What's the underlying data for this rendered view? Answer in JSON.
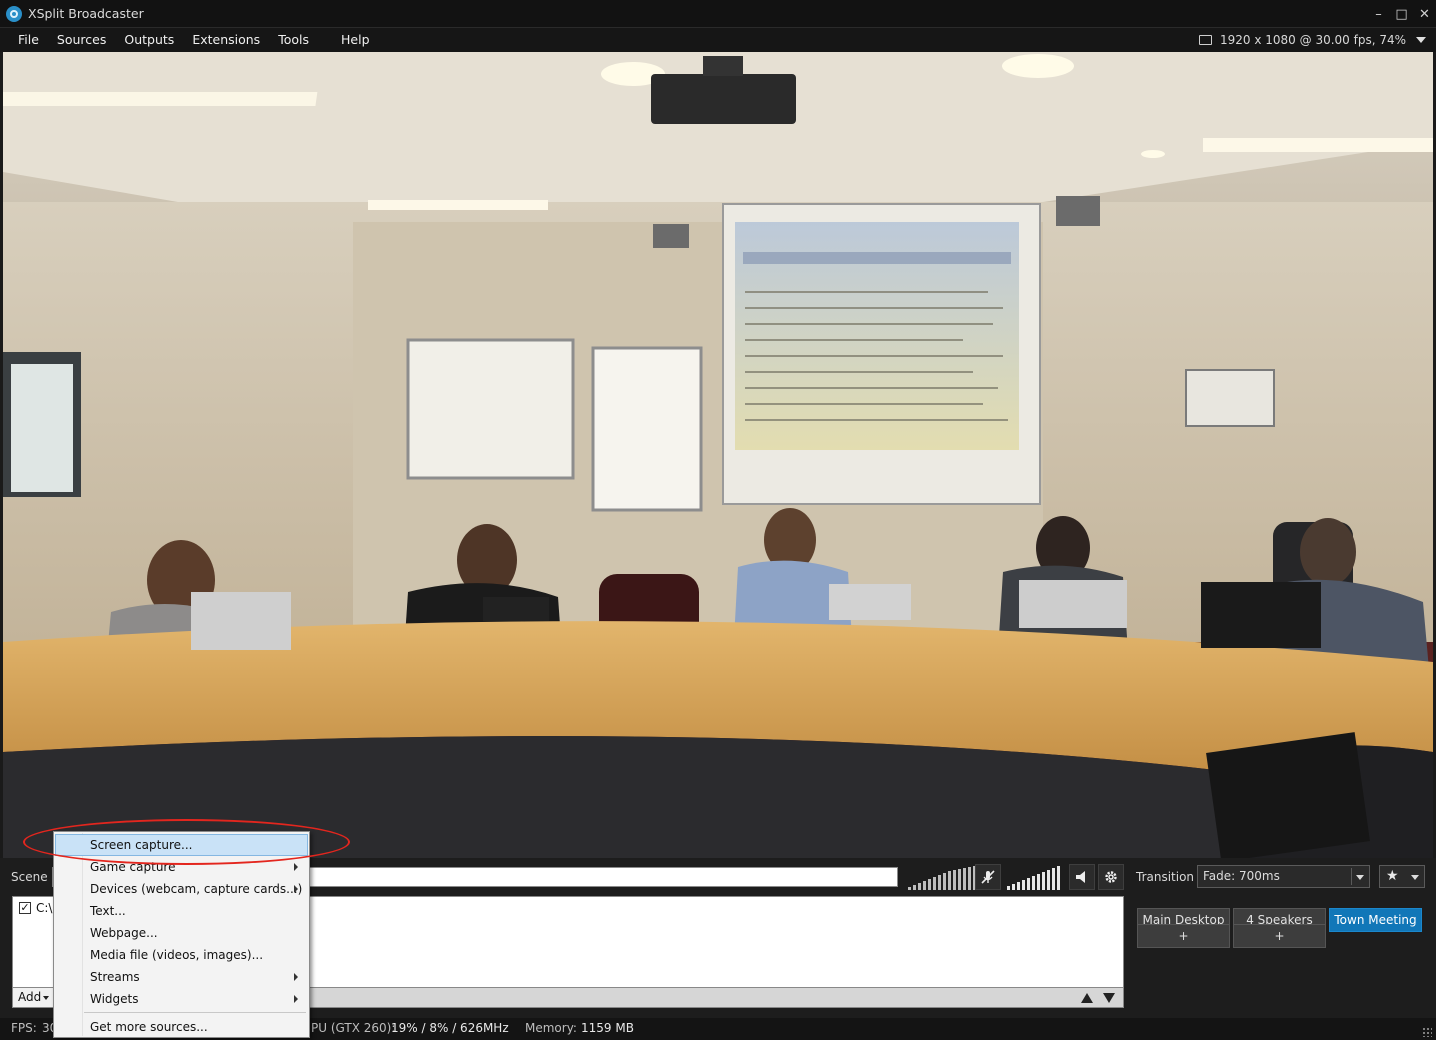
{
  "window": {
    "title": "XSplit Broadcaster",
    "controls": [
      "–",
      "□",
      "✕"
    ]
  },
  "menu": [
    "File",
    "Sources",
    "Outputs",
    "Extensions",
    "Tools",
    "Help"
  ],
  "resolution": "1920 x 1080 @ 30.00 fps, 74%",
  "scene": {
    "label": "Scene"
  },
  "sources": [
    {
      "checked": true,
      "label": "C:\\"
    }
  ],
  "add_button": "Add",
  "context_menu": {
    "items": [
      {
        "label": "Screen capture...",
        "submenu": false,
        "highlighted": true
      },
      {
        "label": "Game capture",
        "submenu": true
      },
      {
        "label": "Devices (webcam, capture cards...)",
        "submenu": true
      },
      {
        "label": "Text...",
        "submenu": false
      },
      {
        "label": "Webpage...",
        "submenu": false
      },
      {
        "label": "Media file (videos, images)...",
        "submenu": false
      },
      {
        "label": "Streams",
        "submenu": true
      },
      {
        "label": "Widgets",
        "submenu": true
      }
    ],
    "footer": "Get more sources..."
  },
  "transition": {
    "label": "Transition",
    "value": "Fade: 700ms"
  },
  "scenes": [
    {
      "label": "Main Desktop",
      "active": false
    },
    {
      "label": "4 Speakers",
      "active": false
    },
    {
      "label": "Town Meeting",
      "active": true
    }
  ],
  "add_scene": "+",
  "status": {
    "fps_label": "FPS:",
    "fps_value": "30",
    "gpu_label": "PU (GTX 260):",
    "gpu_value": "19% / 8% / 626MHz",
    "memory_label": "Memory:",
    "memory_value": "1159 MB"
  },
  "colors": {
    "accent": "#1177b8",
    "highlight": "#c9e2f7",
    "annotation": "#e3261e"
  },
  "icons": [
    "xsplit-logo-icon",
    "monitor-icon",
    "mic-muted-icon",
    "speaker-icon",
    "gear-icon",
    "star-add-icon"
  ]
}
